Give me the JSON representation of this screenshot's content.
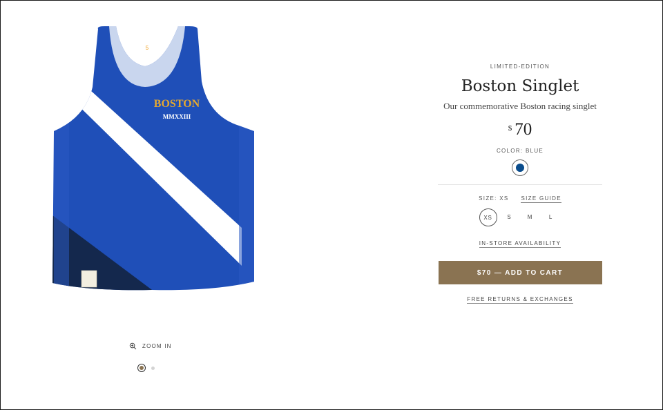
{
  "gallery": {
    "image_icon": "blue-singlet-product-image",
    "logo_text_top": "BOSTON",
    "logo_text_bottom": "MMXXIII",
    "zoom_label": "ZOOM IN",
    "zoom_icon": "magnifier-plus-icon",
    "dots": [
      {
        "active": true
      },
      {
        "active": false
      }
    ]
  },
  "product": {
    "eyebrow": "LIMITED-EDITION",
    "title": "Boston Singlet",
    "subtitle": "Our commemorative Boston racing singlet",
    "currency": "$",
    "price": "70",
    "color_label": "COLOR: BLUE",
    "swatch_color": "#0a4c8c",
    "size_label": "SIZE: XS",
    "size_guide_label": "SIZE GUIDE",
    "sizes": [
      "XS",
      "S",
      "M",
      "L"
    ],
    "selected_size": "XS",
    "instore_label": "IN-STORE AVAILABILITY",
    "cart_label": "$70 — ADD TO CART",
    "returns_label": "FREE RETURNS & EXCHANGES"
  },
  "colors": {
    "accent": "#8a7352",
    "singlet_blue": "#1f4fb8",
    "singlet_navy": "#14284d"
  }
}
